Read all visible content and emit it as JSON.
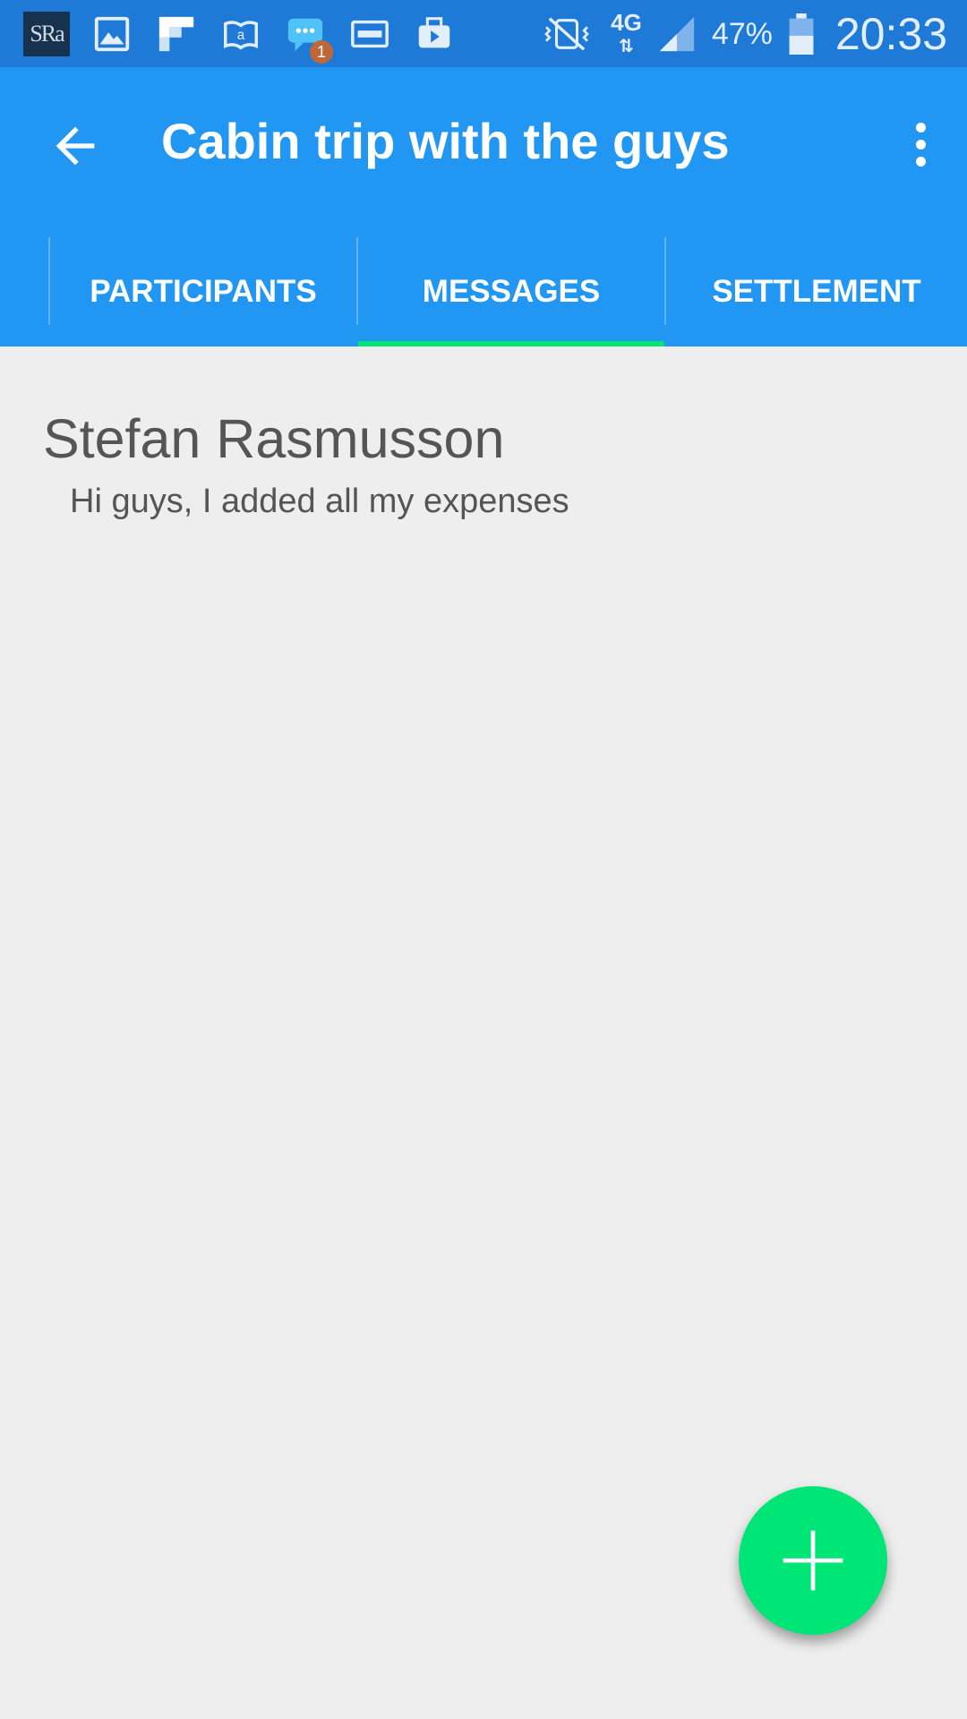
{
  "status_bar": {
    "app_icon_text": "SRa",
    "notification_badge": "1",
    "network": "4G",
    "battery_percent": "47%",
    "time": "20:33"
  },
  "app_bar": {
    "title": "Cabin trip with the guys",
    "tabs": [
      {
        "label": "PARTICIPANTS",
        "selected": false
      },
      {
        "label": "MESSAGES",
        "selected": true
      },
      {
        "label": "SETTLEMENT",
        "selected": false
      }
    ],
    "accent_color": "#00e676",
    "bar_color": "#2196f3"
  },
  "messages": [
    {
      "author": "Stefan Rasmusson",
      "text": "Hi guys, I added all my expenses"
    }
  ],
  "icons": {
    "back": "arrow-left-icon",
    "menu": "more-vert-icon",
    "fab": "plus-icon"
  }
}
